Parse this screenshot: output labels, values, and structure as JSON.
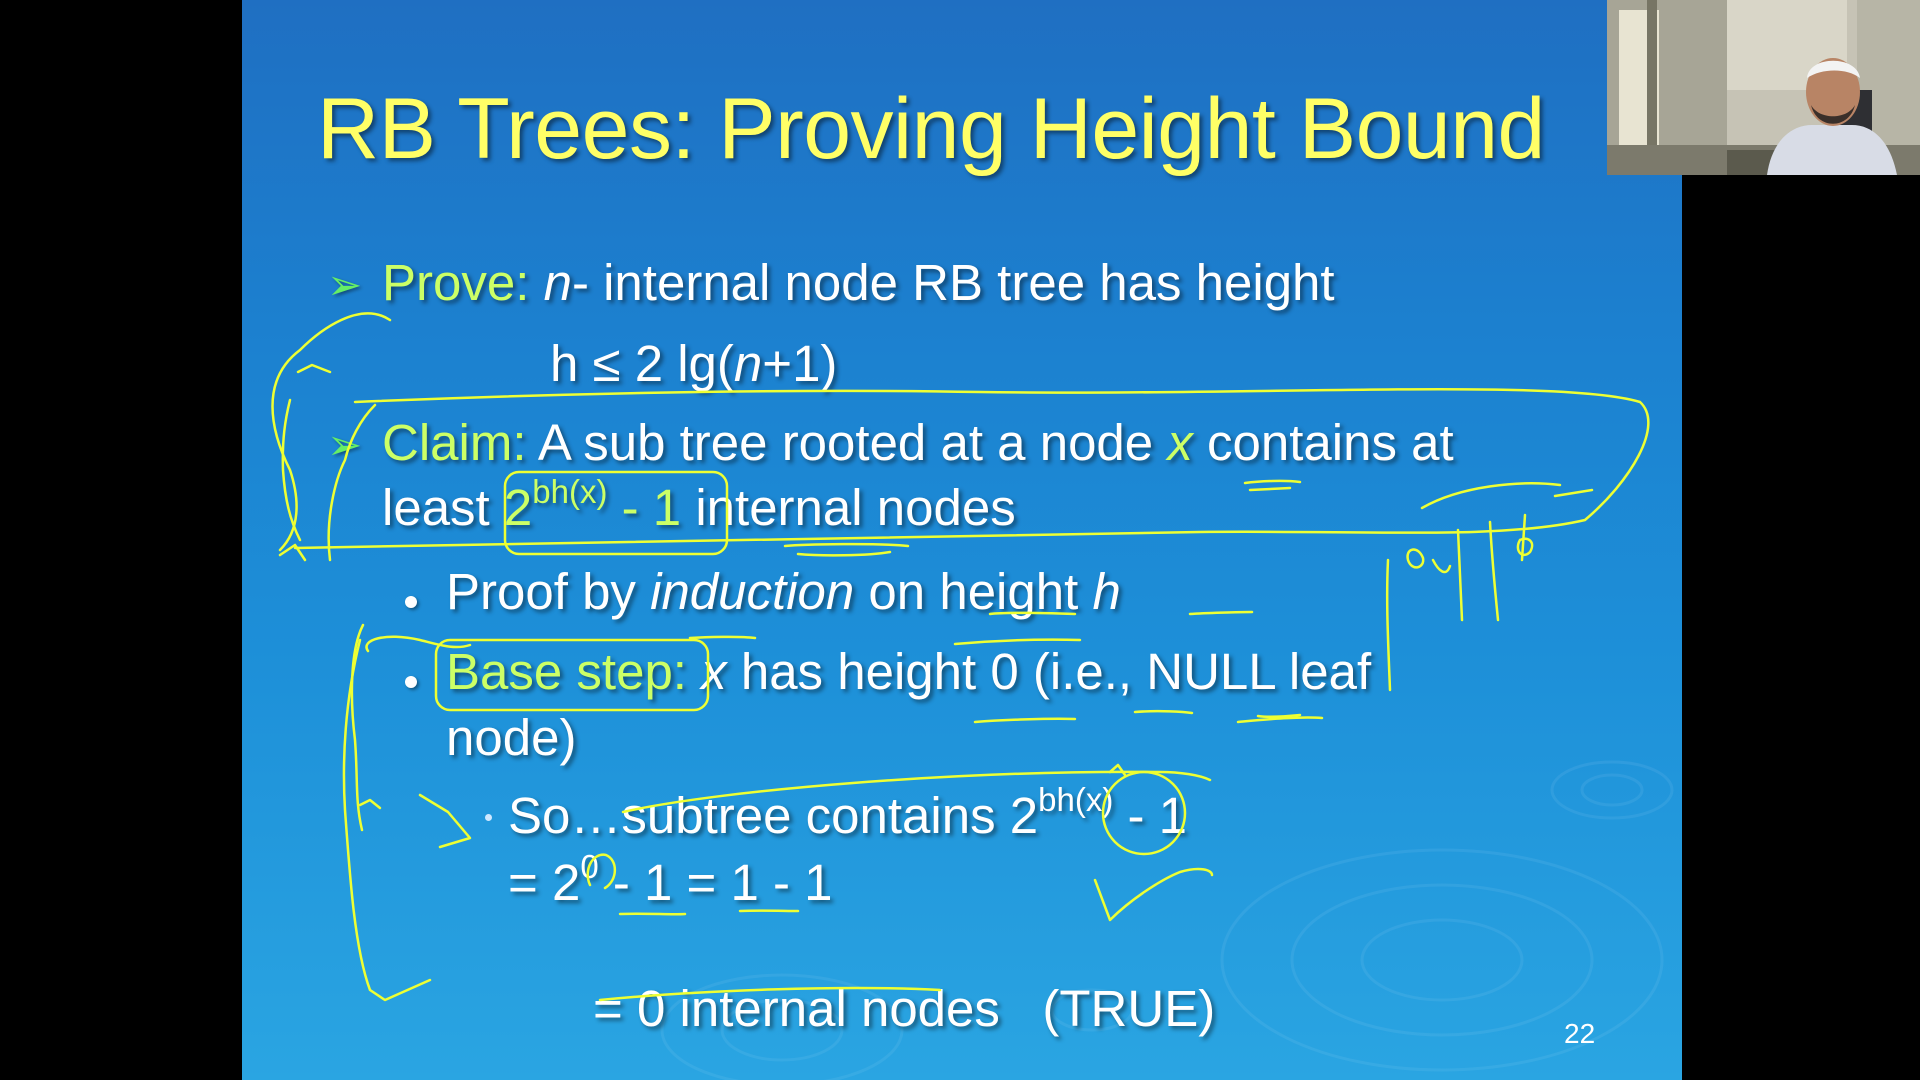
{
  "slide": {
    "title": "RB Trees: Proving Height Bound",
    "page_number": "22",
    "bullets": {
      "prove_label": "Prove:",
      "prove_n": "n",
      "prove_text": "- internal node RB tree has height",
      "bound_h": "h ≤ 2 lg(",
      "bound_n": "n",
      "bound_end": "+1)",
      "claim_label": "Claim:",
      "claim_text1": " A sub tree rooted at a node ",
      "claim_x": "x",
      "claim_text2": " contains at",
      "claim_least": "least ",
      "claim_2": "2",
      "claim_sup": "bh(x)",
      "claim_minus": " - 1 ",
      "claim_end": "internal nodes",
      "proof_pre": "Proof by ",
      "proof_ital": "induction",
      "proof_post": " on height ",
      "proof_h": "h",
      "base_label": "Base step:",
      "base_x": " x",
      "base_text": " has height 0 (i.e., NULL leaf",
      "base_text2": "node)",
      "so_text": "So…subtree contains 2",
      "so_sup": "bh(x)",
      "so_end": " - 1",
      "eq1_pre": "= 2",
      "eq1_sup": "0",
      "eq1_post": " - 1 = 1 - 1",
      "eq2": "= 0 internal nodes   (TRUE)"
    }
  },
  "colors": {
    "title": "#ffff66",
    "label_green": "#ccff66",
    "ink": "#eeff33",
    "slide_bg": "#1d8fd8"
  },
  "icons": {
    "arrow_bullet": "arrow-bullet-icon",
    "dot_bullet": "dot-bullet-icon"
  }
}
